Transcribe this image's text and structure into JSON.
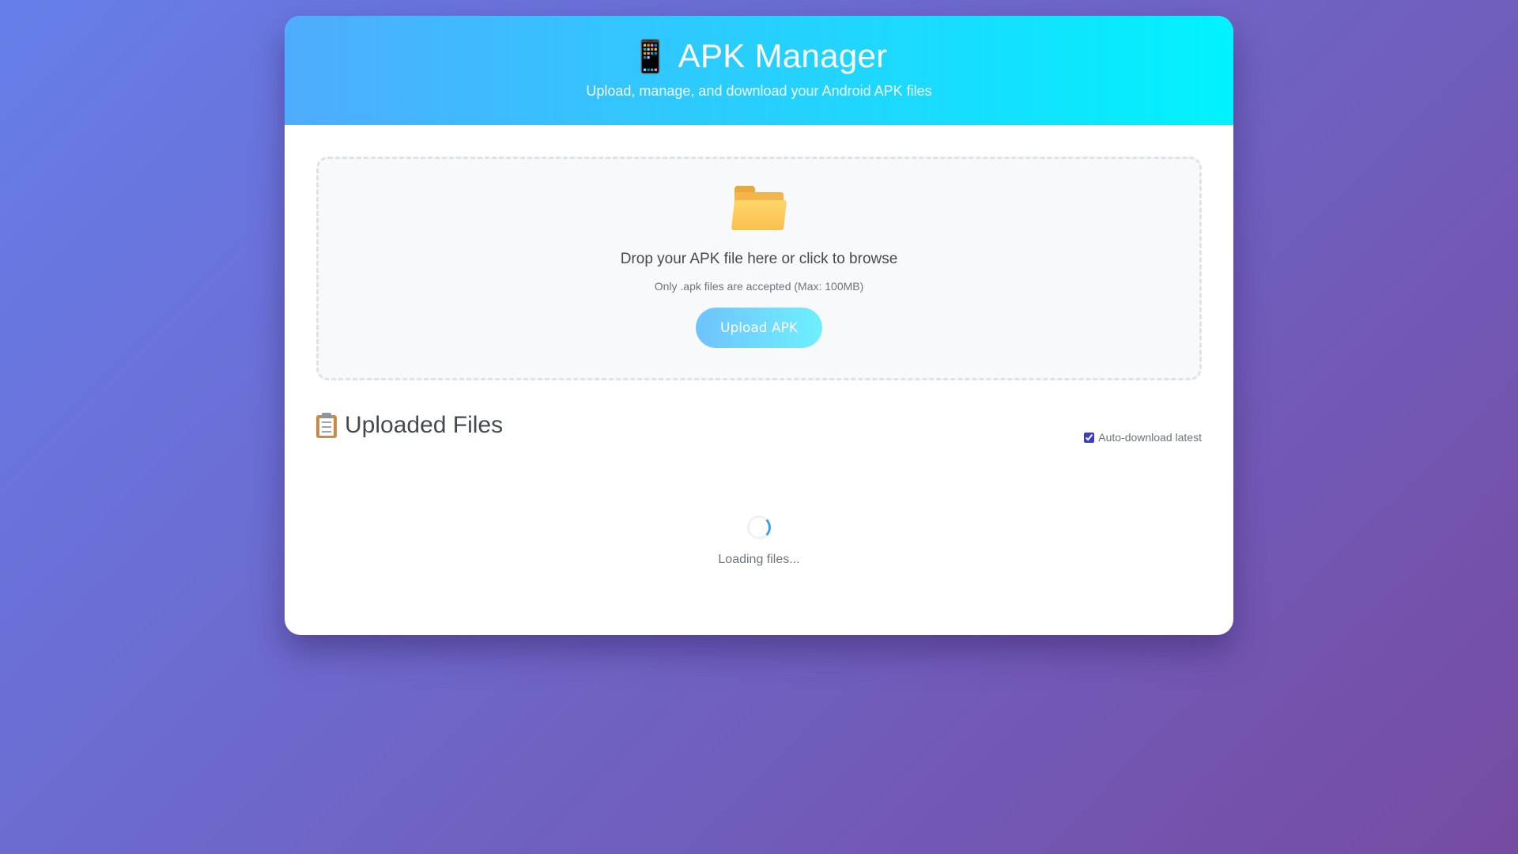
{
  "header": {
    "icon": "mobile-phone-icon",
    "title": "APK Manager",
    "subtitle": "Upload, manage, and download your Android APK files"
  },
  "dropzone": {
    "icon": "folder-icon",
    "title": "Drop your APK file here or click to browse",
    "subtitle": "Only .apk files are accepted (Max: 100MB)",
    "button_label": "Upload APK"
  },
  "files": {
    "icon": "clipboard-icon",
    "title": "Uploaded Files",
    "auto_download_label": "Auto-download latest",
    "auto_download_checked": true,
    "loading_text": "Loading files..."
  },
  "colors": {
    "background_start": "#667eea",
    "background_end": "#764ba2",
    "header_start": "#4facfe",
    "header_end": "#00f2fe",
    "spinner_accent": "#3aa0f0"
  }
}
